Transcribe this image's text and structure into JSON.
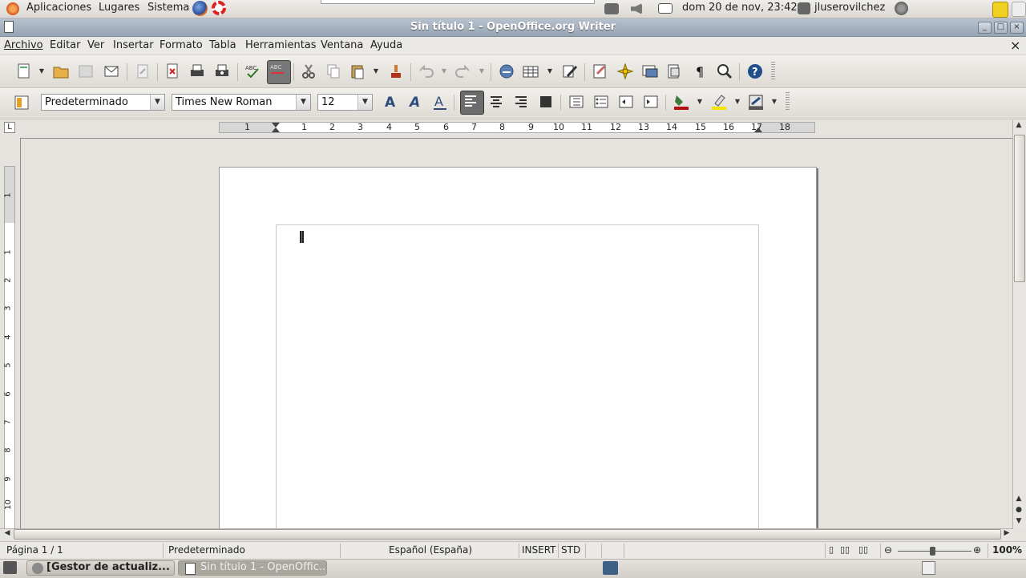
{
  "top_panel": {
    "menus": [
      "Aplicaciones",
      "Lugares",
      "Sistema"
    ],
    "clock": "dom 20 de nov, 23:42",
    "user": "jluserovilchez"
  },
  "window": {
    "title": "Sin título 1 - OpenOffice.org Writer"
  },
  "menubar": [
    "Archivo",
    "Editar",
    "Ver",
    "Insertar",
    "Formato",
    "Tabla",
    "Herramientas",
    "Ventana",
    "Ayuda"
  ],
  "formatting": {
    "style": "Predeterminado",
    "font": "Times New Roman",
    "size": "12"
  },
  "ruler": {
    "h_numbers": [
      "1",
      "1",
      "2",
      "3",
      "4",
      "5",
      "6",
      "7",
      "8",
      "9",
      "10",
      "11",
      "12",
      "13",
      "14",
      "15",
      "16",
      "17",
      "18"
    ],
    "v_numbers": [
      "1",
      "1",
      "2",
      "3",
      "4",
      "5",
      "6",
      "7",
      "8",
      "9",
      "10"
    ]
  },
  "statusbar": {
    "page": "Página 1 / 1",
    "style": "Predeterminado",
    "language": "Español (España)",
    "insert_mode": "INSERT",
    "selection_mode": "STD",
    "zoom": "100%"
  },
  "taskbar": {
    "items": [
      "[Gestor de actualiz...",
      "Sin título 1 - OpenOffic..."
    ]
  },
  "colors": {
    "titlebar": "#9aa8b7",
    "page": "#ffffff",
    "workspace": "#e6e3df"
  }
}
